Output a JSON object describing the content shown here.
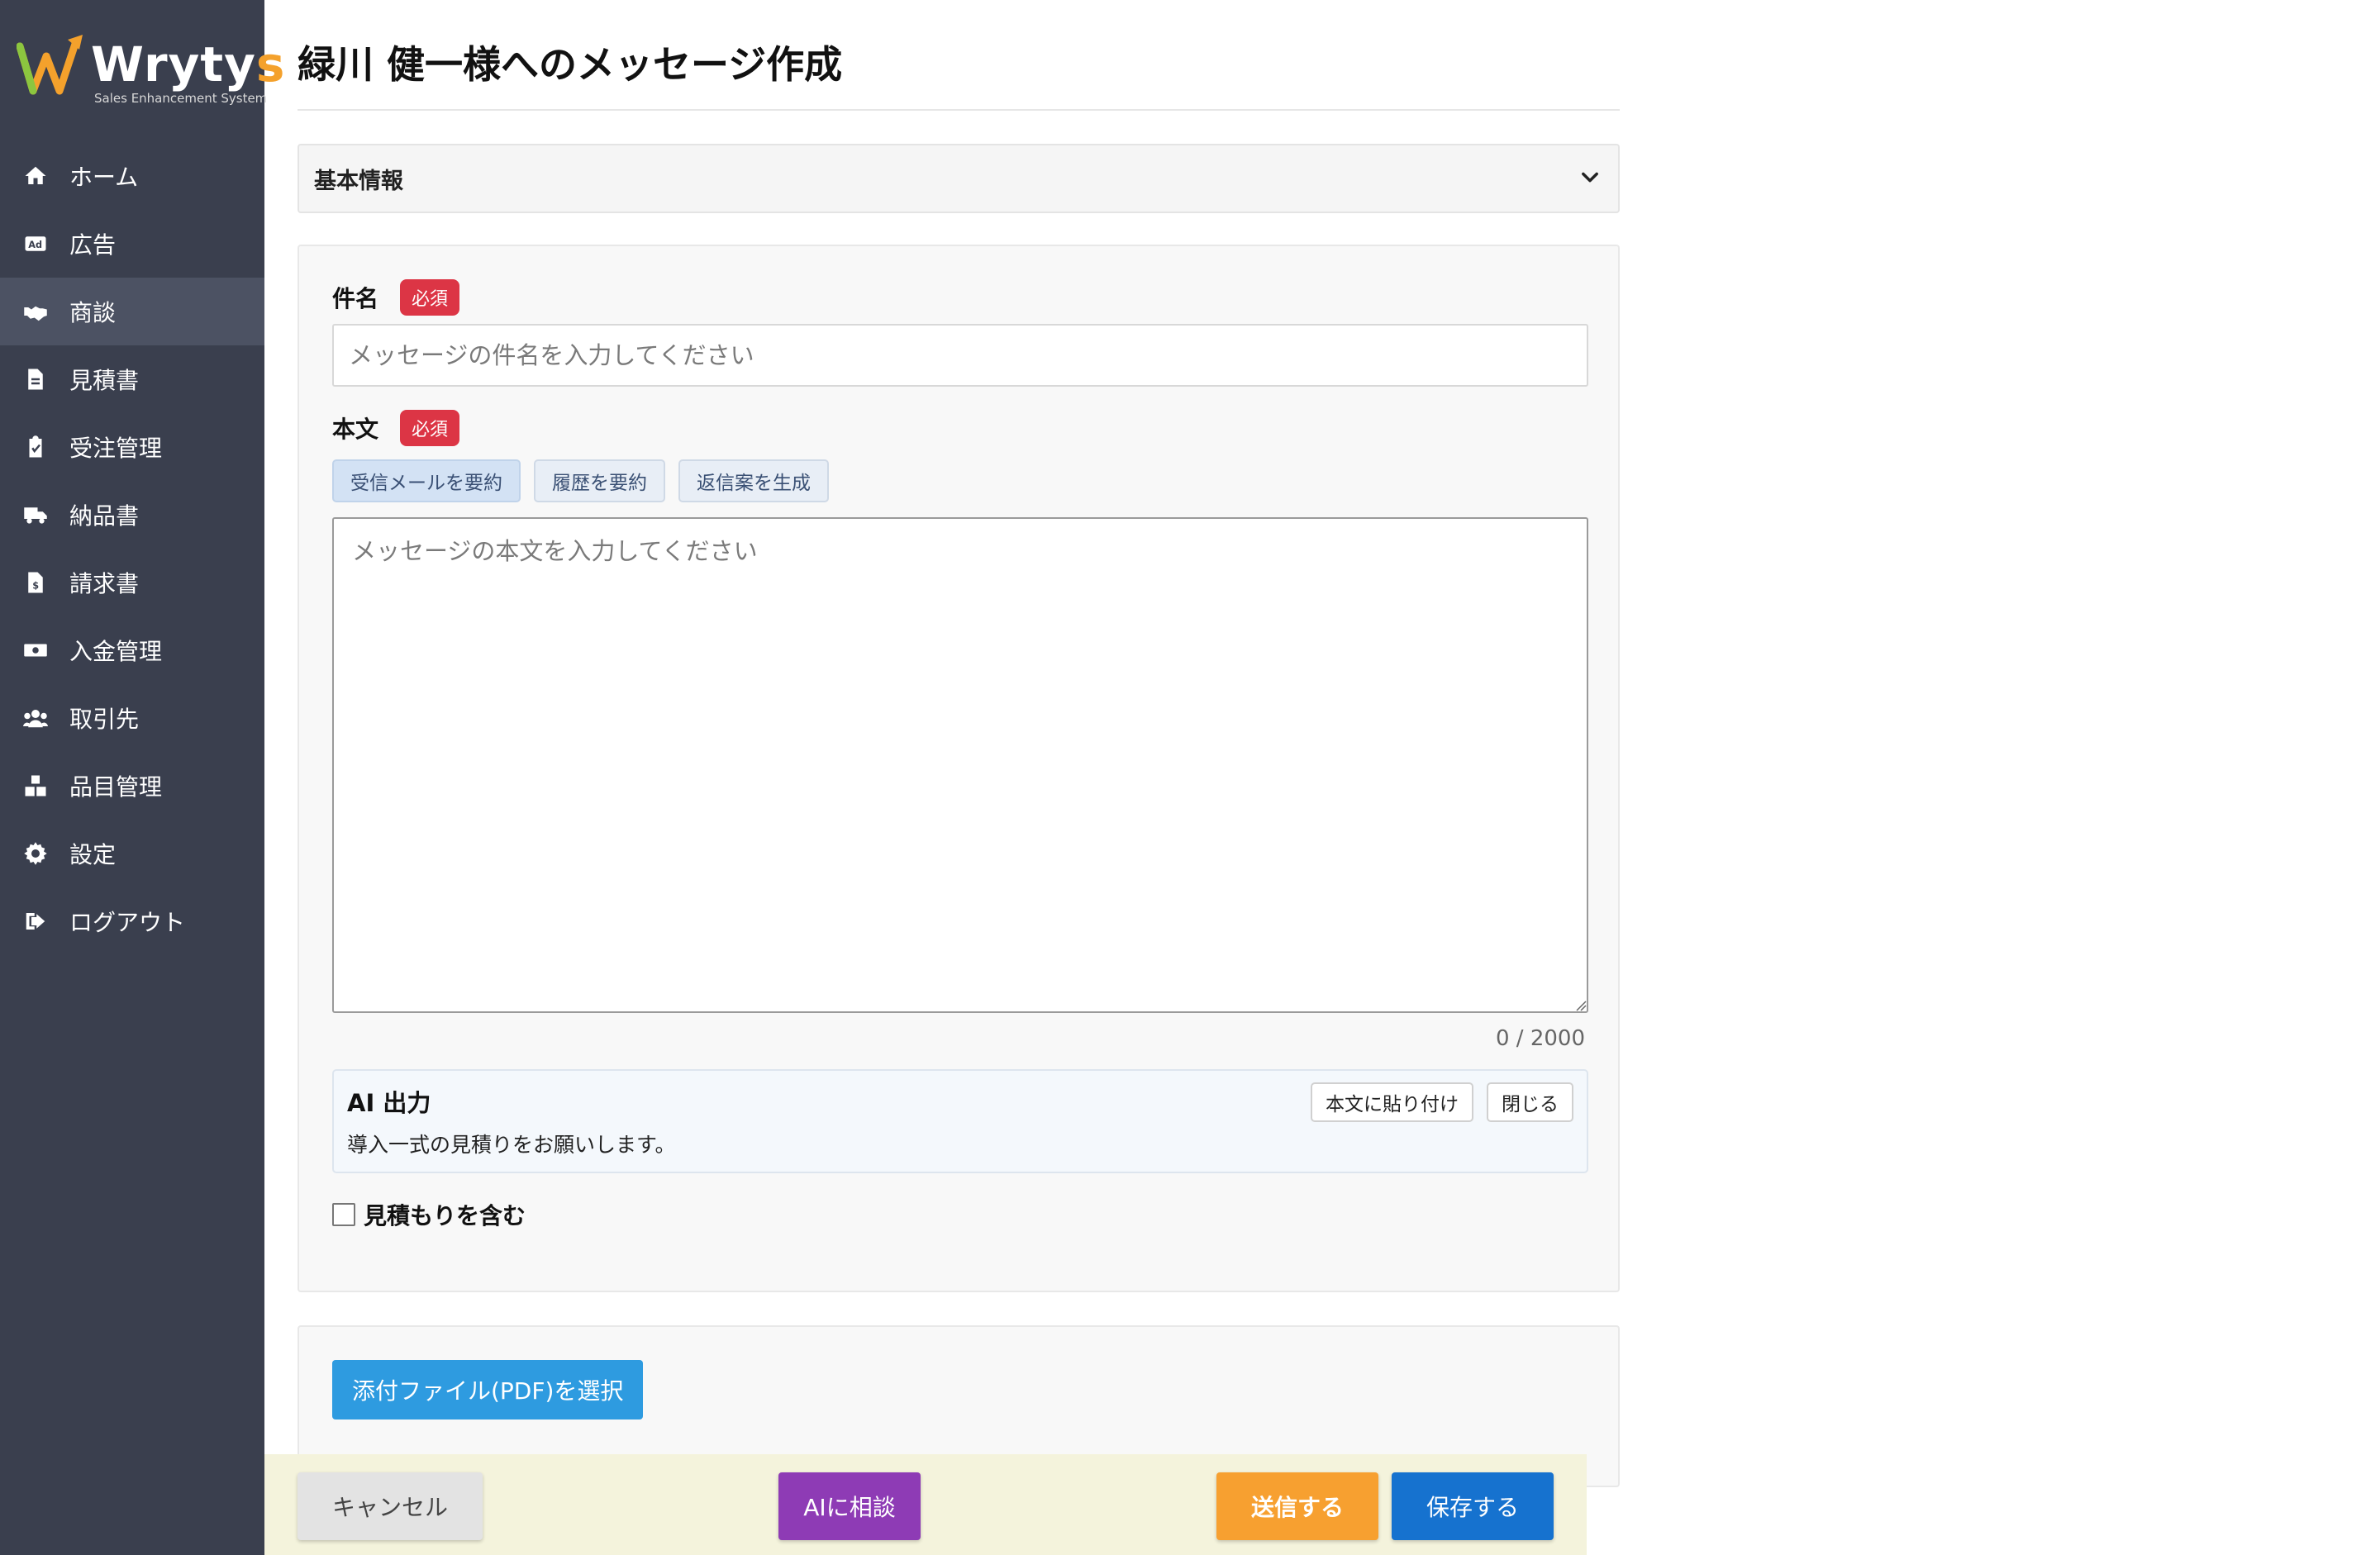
{
  "brand": {
    "name_main": "Wryty",
    "name_accent": "s",
    "tagline": "Sales Enhancement System"
  },
  "sidebar": {
    "items": [
      {
        "label": "ホーム",
        "icon": "home-icon"
      },
      {
        "label": "広告",
        "icon": "ad-icon"
      },
      {
        "label": "商談",
        "icon": "handshake-icon",
        "active": true
      },
      {
        "label": "見積書",
        "icon": "document-icon"
      },
      {
        "label": "受注管理",
        "icon": "clipboard-check-icon"
      },
      {
        "label": "納品書",
        "icon": "truck-icon"
      },
      {
        "label": "請求書",
        "icon": "invoice-icon"
      },
      {
        "label": "入金管理",
        "icon": "money-icon"
      },
      {
        "label": "取引先",
        "icon": "users-icon"
      },
      {
        "label": "品目管理",
        "icon": "boxes-icon"
      },
      {
        "label": "設定",
        "icon": "gear-icon"
      },
      {
        "label": "ログアウト",
        "icon": "logout-icon"
      }
    ]
  },
  "page": {
    "title": "緑川 健一様へのメッセージ作成"
  },
  "basic_info": {
    "title": "基本情報"
  },
  "form": {
    "subject_label": "件名",
    "required_badge": "必須",
    "subject_placeholder": "メッセージの件名を入力してください",
    "subject_value": "",
    "body_label": "本文",
    "body_placeholder": "メッセージの本文を入力してください",
    "body_value": "",
    "ai_buttons": [
      "受信メールを要約",
      "履歴を要約",
      "返信案を生成"
    ],
    "counter": "0 / 2000",
    "ai_output": {
      "title": "AI 出力",
      "text": "導入一式の見積りをお願いします。",
      "paste_label": "本文に貼り付け",
      "close_label": "閉じる"
    },
    "include_estimate_label": "見積もりを含む",
    "include_estimate_checked": false
  },
  "attachment": {
    "button_label": "添付ファイル(PDF)を選択"
  },
  "footer": {
    "cancel_label": "キャンセル",
    "ai_label": "AIに相談",
    "send_label": "送信する",
    "save_label": "保存する"
  },
  "colors": {
    "sidebar_bg": "#3a3f4e",
    "required_badge": "#dc3545",
    "send": "#f7a030",
    "save": "#1672cf",
    "ai_consult": "#8e3bb5",
    "attach": "#2e9be0"
  }
}
